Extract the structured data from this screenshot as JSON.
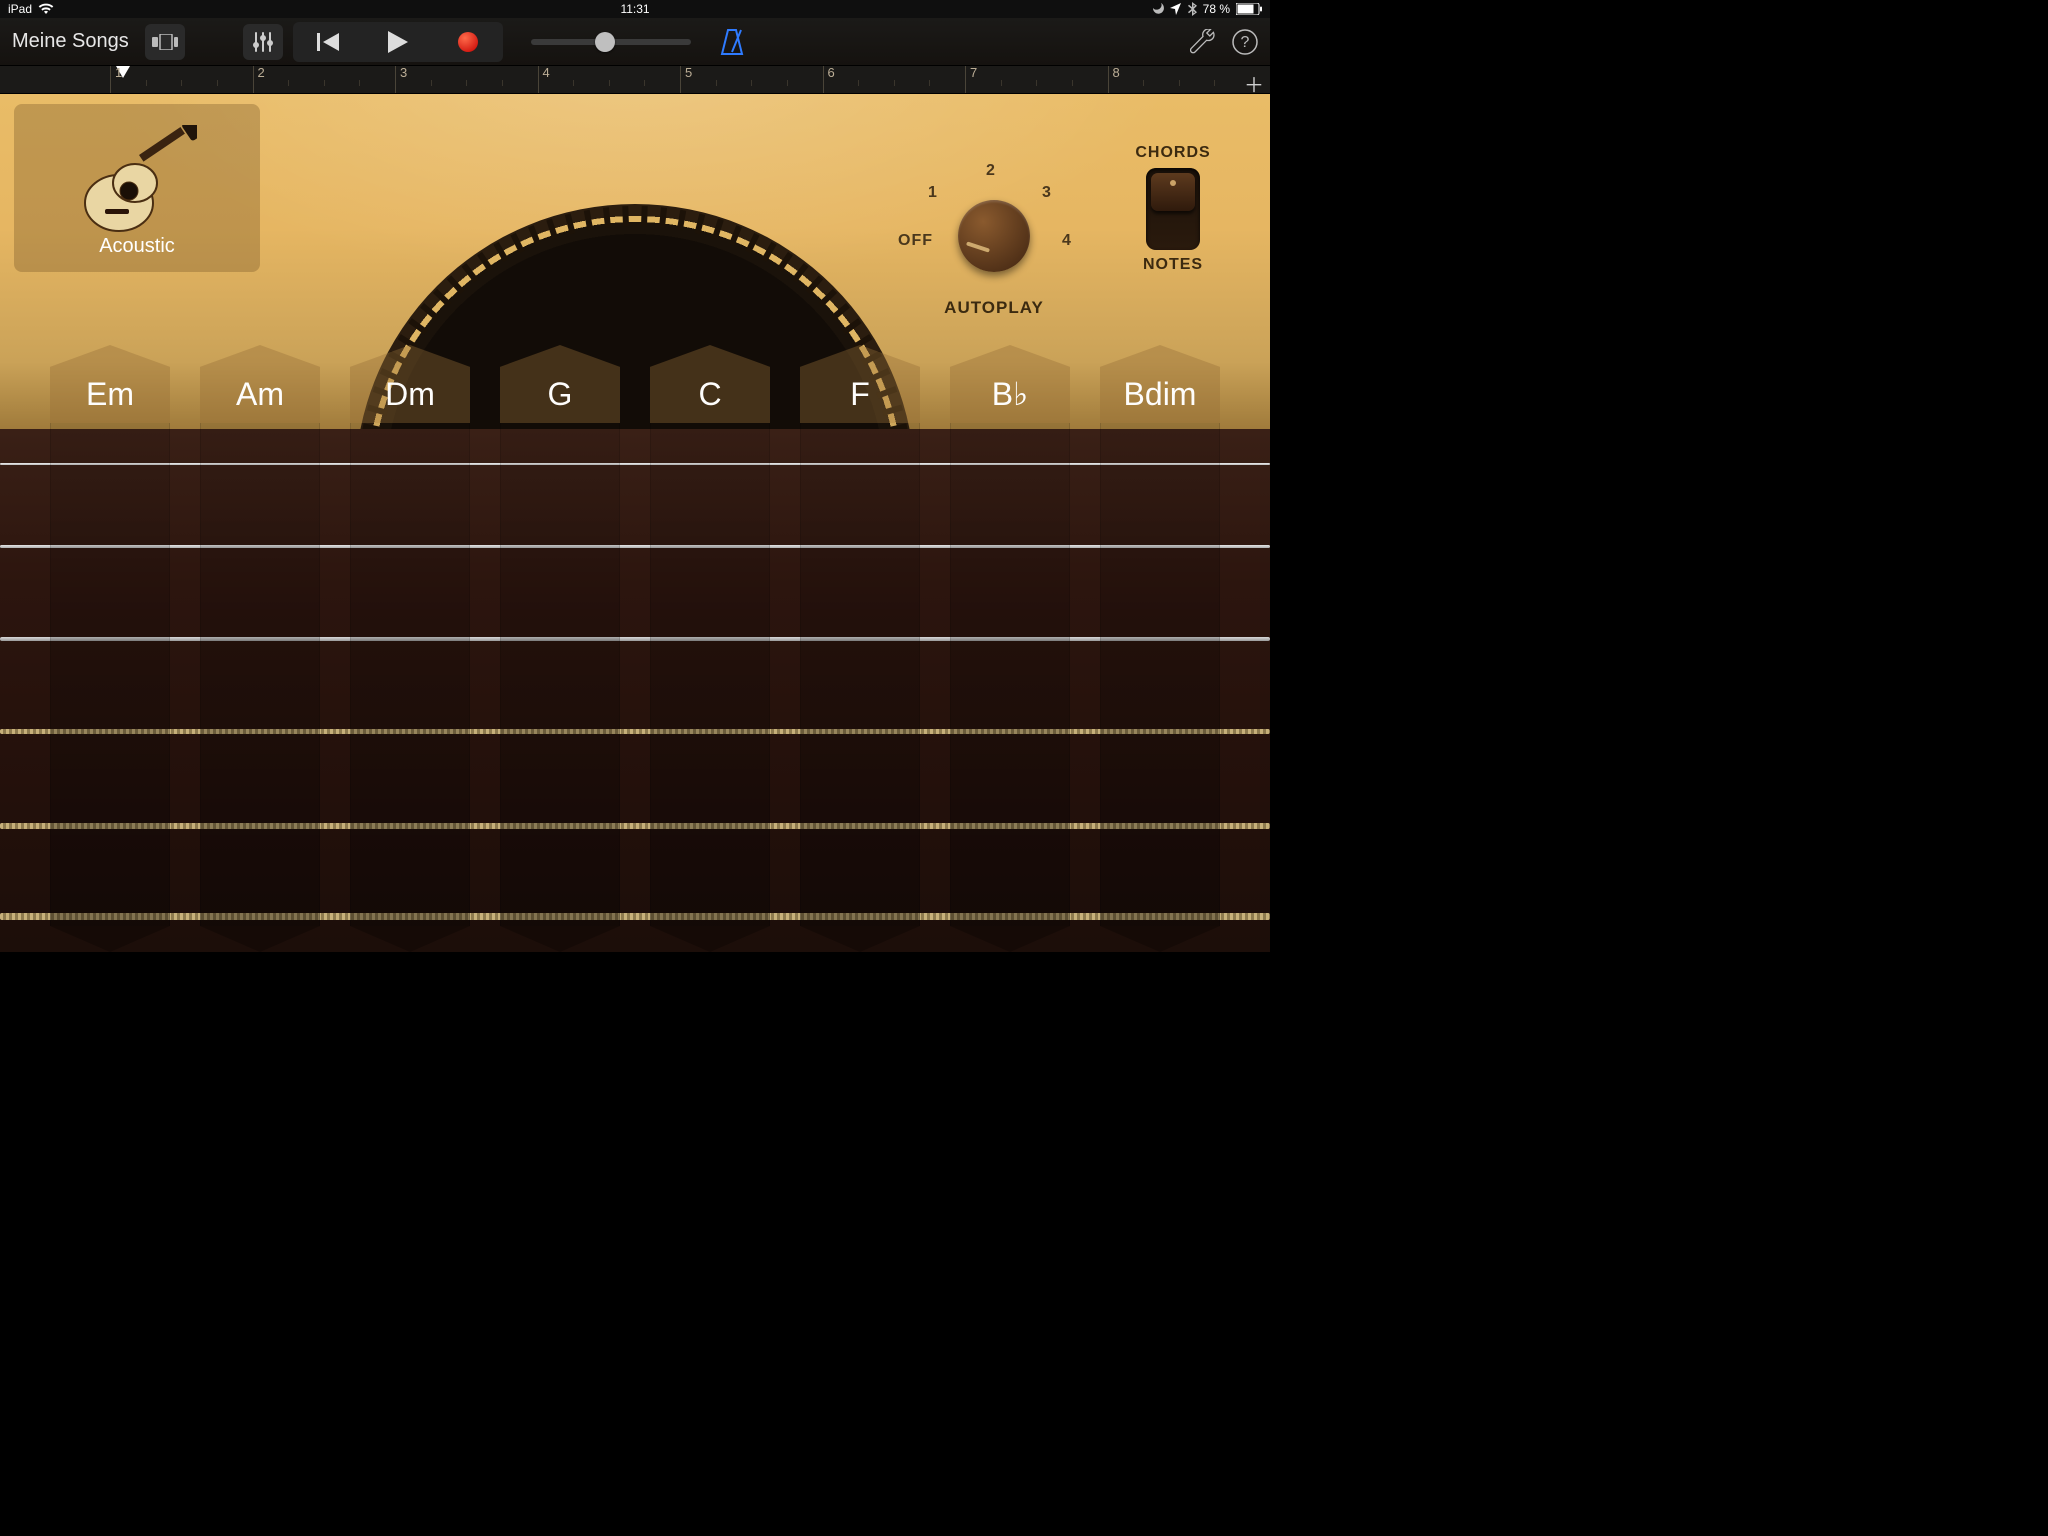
{
  "status": {
    "device": "iPad",
    "time": "11:31",
    "battery_pct": "78 %"
  },
  "toolbar": {
    "songs_link": "Meine Songs"
  },
  "ruler": {
    "bars": [
      "1",
      "2",
      "3",
      "4",
      "5",
      "6",
      "7",
      "8"
    ]
  },
  "instrument": {
    "name": "Acoustic"
  },
  "autoplay": {
    "title": "AUTOPLAY",
    "labels": {
      "off": "OFF",
      "p1": "1",
      "p2": "2",
      "p3": "3",
      "p4": "4"
    }
  },
  "mode": {
    "top": "CHORDS",
    "bottom": "NOTES"
  },
  "chords": [
    "Em",
    "Am",
    "Dm",
    "G",
    "C",
    "F",
    "B♭",
    "Bdim"
  ]
}
